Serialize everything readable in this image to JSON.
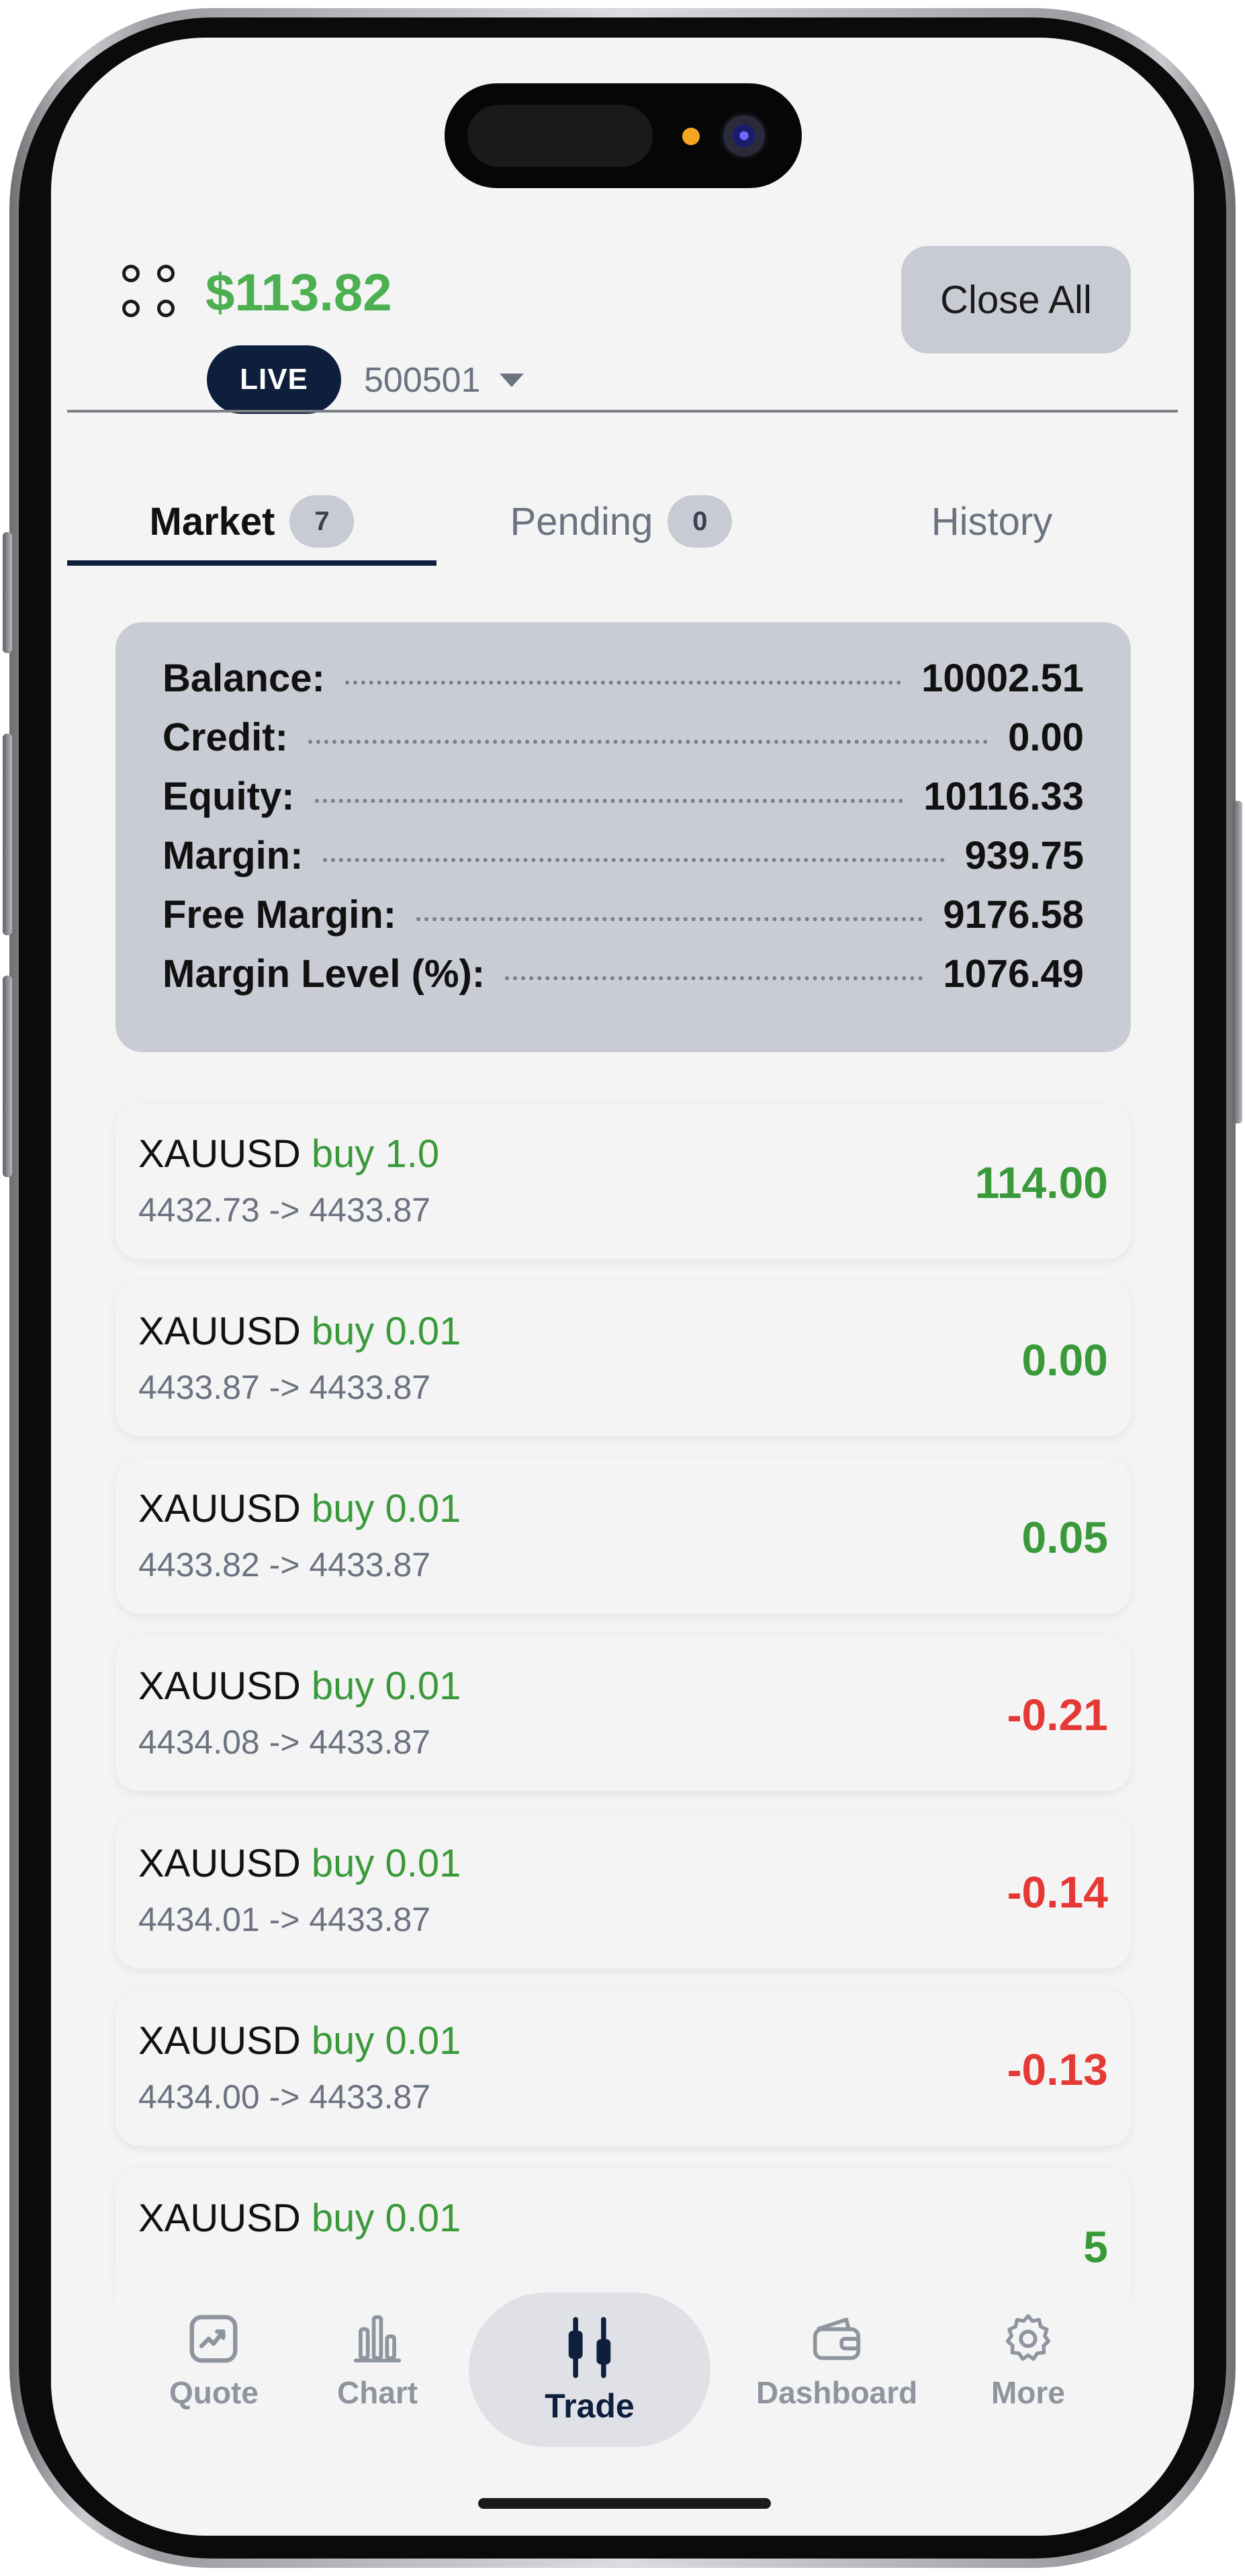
{
  "header": {
    "balance": "$113.82",
    "mode_badge": "LIVE",
    "account_number": "500501",
    "close_all_label": "Close All"
  },
  "tabs": [
    {
      "label": "Market",
      "count": "7",
      "active": true
    },
    {
      "label": "Pending",
      "count": "0",
      "active": false
    },
    {
      "label": "History",
      "active": false
    }
  ],
  "summary": [
    {
      "label": "Balance:",
      "value": "10002.51"
    },
    {
      "label": "Credit:",
      "value": "0.00"
    },
    {
      "label": "Equity:",
      "value": "10116.33"
    },
    {
      "label": "Margin:",
      "value": "939.75"
    },
    {
      "label": "Free Margin:",
      "value": "9176.58"
    },
    {
      "label": "Margin Level (%):",
      "value": "1076.49"
    }
  ],
  "positions": [
    {
      "symbol": "XAUUSD",
      "side": "buy 1.0",
      "prices": "4432.73 -> 4433.87",
      "profit": "114.00"
    },
    {
      "symbol": "XAUUSD",
      "side": "buy 0.01",
      "prices": "4433.87 -> 4433.87",
      "profit": "0.00"
    },
    {
      "symbol": "XAUUSD",
      "side": "buy 0.01",
      "prices": "4433.82 -> 4433.87",
      "profit": "0.05"
    },
    {
      "symbol": "XAUUSD",
      "side": "buy 0.01",
      "prices": "4434.08 -> 4433.87",
      "profit": "-0.21"
    },
    {
      "symbol": "XAUUSD",
      "side": "buy 0.01",
      "prices": "4434.01 -> 4433.87",
      "profit": "-0.14"
    },
    {
      "symbol": "XAUUSD",
      "side": "buy 0.01",
      "prices": "4434.00 -> 4433.87",
      "profit": "-0.13"
    },
    {
      "symbol": "XAUUSD",
      "side": "buy 0.01",
      "prices": "",
      "profit": "5"
    }
  ],
  "nav": {
    "quote": "Quote",
    "chart": "Chart",
    "trade": "Trade",
    "dashboard": "Dashboard",
    "more": "More"
  },
  "colors": {
    "profit_positive": "#3a9a3a",
    "profit_negative": "#e53935",
    "balance_green": "#4caf50",
    "brand_navy": "#0d1f3c"
  }
}
